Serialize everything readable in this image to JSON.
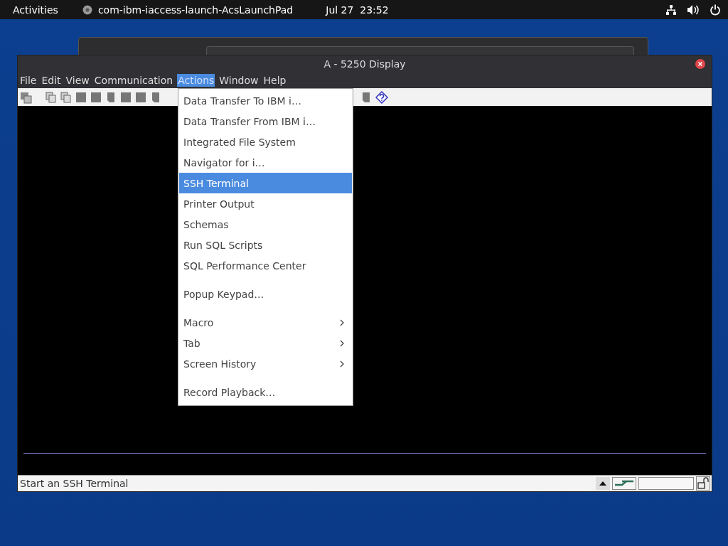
{
  "top_bar": {
    "activities": "Activities",
    "app_name": "com-ibm-iaccess-launch-AcsLaunchPad",
    "date": "Jul 27",
    "time": "23:52"
  },
  "window": {
    "title": "A - 5250 Display"
  },
  "menubar": [
    {
      "label": "File",
      "selected": false
    },
    {
      "label": "Edit",
      "selected": false
    },
    {
      "label": "View",
      "selected": false
    },
    {
      "label": "Communication",
      "selected": false
    },
    {
      "label": "Actions",
      "selected": true
    },
    {
      "label": "Window",
      "selected": false
    },
    {
      "label": "Help",
      "selected": false
    }
  ],
  "menu": [
    {
      "kind": "item",
      "label": "Data Transfer To IBM i…",
      "selected": false
    },
    {
      "kind": "item",
      "label": "Data Transfer From IBM i…",
      "selected": false
    },
    {
      "kind": "item",
      "label": "Integrated File System",
      "selected": false
    },
    {
      "kind": "item",
      "label": "Navigator for i…",
      "selected": false
    },
    {
      "kind": "item",
      "label": "SSH Terminal",
      "selected": true
    },
    {
      "kind": "item",
      "label": "Printer Output",
      "selected": false
    },
    {
      "kind": "item",
      "label": "Schemas",
      "selected": false
    },
    {
      "kind": "item",
      "label": "Run SQL Scripts",
      "selected": false
    },
    {
      "kind": "item",
      "label": "SQL Performance Center",
      "selected": false
    },
    {
      "kind": "separator"
    },
    {
      "kind": "item",
      "label": "Popup Keypad…",
      "selected": false
    },
    {
      "kind": "separator"
    },
    {
      "kind": "submenu",
      "label": "Macro",
      "selected": false
    },
    {
      "kind": "submenu",
      "label": "Tab",
      "selected": false
    },
    {
      "kind": "submenu",
      "label": "Screen History",
      "selected": false
    },
    {
      "kind": "separator"
    },
    {
      "kind": "item",
      "label": "Record Playback…",
      "selected": false
    }
  ],
  "status_bar": {
    "message": "Start an SSH Terminal"
  }
}
